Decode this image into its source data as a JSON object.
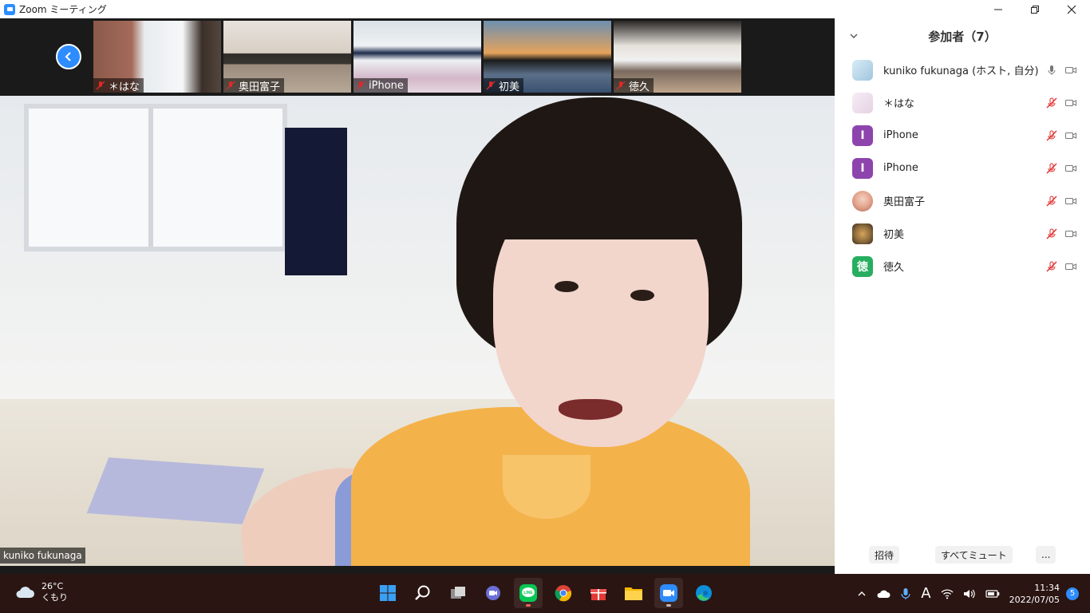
{
  "window": {
    "title": "Zoom ミーティング"
  },
  "thumbnails": [
    {
      "name": "＊はな"
    },
    {
      "name": "奥田富子"
    },
    {
      "name": "iPhone"
    },
    {
      "name": "初美"
    },
    {
      "name": "徳久"
    }
  ],
  "main": {
    "speaker_name": "kuniko fukunaga"
  },
  "participants_panel": {
    "title": "参加者（7）",
    "participants": [
      {
        "name": "kuniko fukunaga (ホスト, 自分)",
        "avatar_letter": "",
        "avatar_color": "#bcd7ea"
      },
      {
        "name": "＊はな",
        "avatar_letter": "",
        "avatar_color": "#efe4ef"
      },
      {
        "name": "iPhone",
        "avatar_letter": "I",
        "avatar_color": "#8e44ad"
      },
      {
        "name": "iPhone",
        "avatar_letter": "I",
        "avatar_color": "#8e44ad"
      },
      {
        "name": "奥田富子",
        "avatar_letter": "",
        "avatar_color": "#e9b6a8"
      },
      {
        "name": "初美",
        "avatar_letter": "",
        "avatar_color": "#8a6a3d"
      },
      {
        "name": "徳久",
        "avatar_letter": "徳",
        "avatar_color": "#27ae60"
      }
    ],
    "invite_label": "招待",
    "mute_all_label": "すべてミュート",
    "more_label": "..."
  },
  "taskbar": {
    "weather_temp": "26°C",
    "weather_desc": "くもり",
    "ime_indicator": "A",
    "time": "11:34",
    "date": "2022/07/05",
    "notification_count": "5"
  },
  "colors": {
    "accent": "#2d8cff",
    "muted_red": "#e02828"
  }
}
